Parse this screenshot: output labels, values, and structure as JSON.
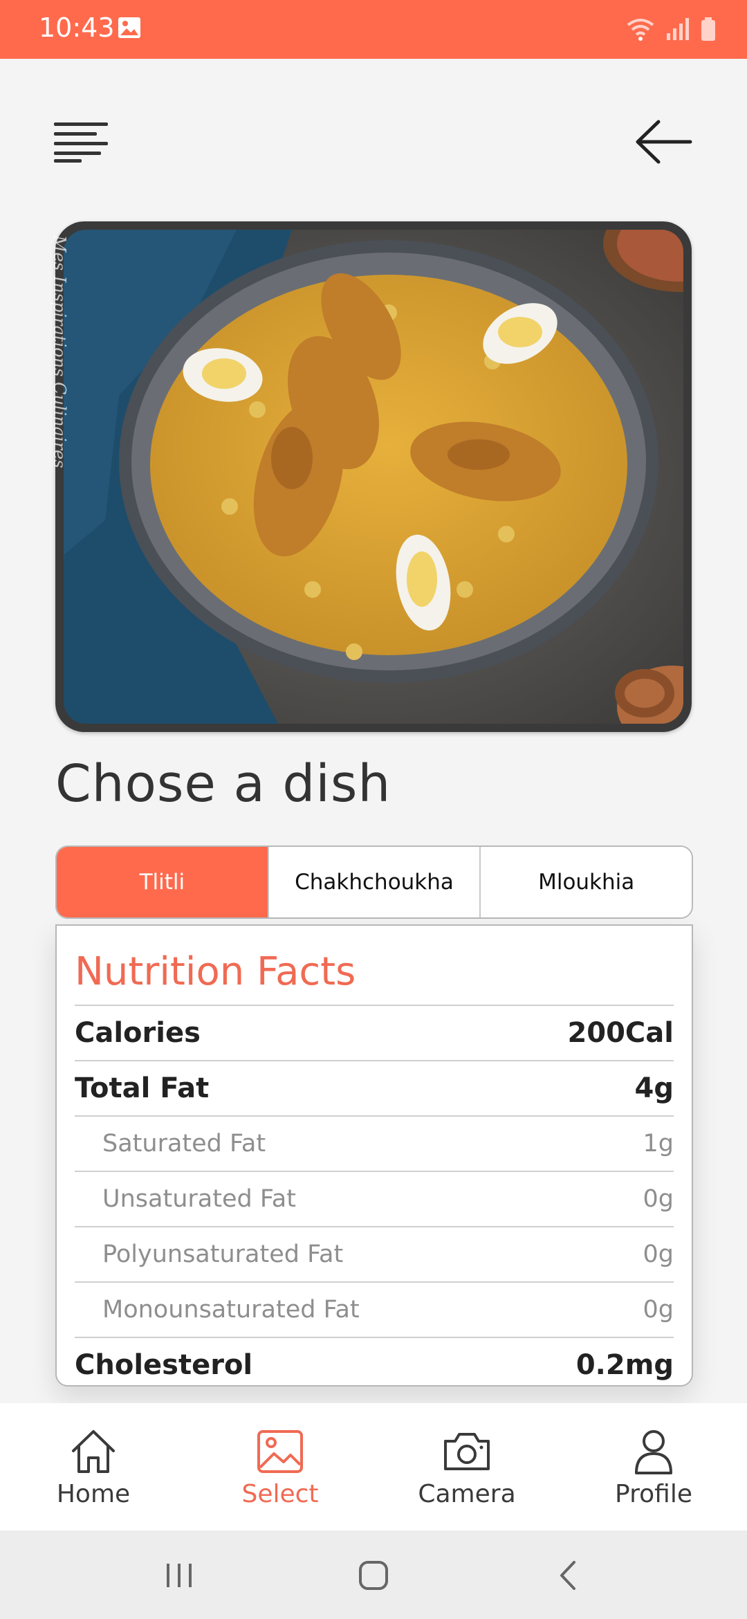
{
  "status_bar": {
    "time": "10:43",
    "icons": [
      "image-icon",
      "wifi-icon",
      "signal-icon",
      "battery-icon"
    ]
  },
  "top_bar": {
    "menu_icon": "menu-icon",
    "back_icon": "arrow-left-icon"
  },
  "hero": {
    "watermark": "Mes Inspirations Culinaires"
  },
  "title": "Chose a dish",
  "tabs": [
    {
      "label": "Tlitli",
      "active": true
    },
    {
      "label": "Chakhchoukha",
      "active": false
    },
    {
      "label": "Mloukhia",
      "active": false
    }
  ],
  "nutrition": {
    "title": "Nutrition Facts",
    "rows": [
      {
        "label": "Calories",
        "value": "200Cal",
        "level": "major"
      },
      {
        "label": "Total Fat",
        "value": "4g",
        "level": "major"
      },
      {
        "label": "Saturated Fat",
        "value": "1g",
        "level": "minor"
      },
      {
        "label": "Unsaturated Fat",
        "value": "0g",
        "level": "minor"
      },
      {
        "label": "Polyunsaturated Fat",
        "value": "0g",
        "level": "minor"
      },
      {
        "label": "Monounsaturated Fat",
        "value": "0g",
        "level": "minor"
      },
      {
        "label": "Cholesterol",
        "value": "0.2mg",
        "level": "major"
      }
    ]
  },
  "bottom_nav": [
    {
      "label": "Home",
      "icon": "home-icon",
      "active": false
    },
    {
      "label": "Select",
      "icon": "image-icon",
      "active": true
    },
    {
      "label": "Camera",
      "icon": "camera-icon",
      "active": false
    },
    {
      "label": "Profile",
      "icon": "profile-icon",
      "active": false
    }
  ],
  "colors": {
    "accent": "#ff6a4d",
    "accent_text": "#f06a53",
    "background": "#f4f4f4"
  }
}
